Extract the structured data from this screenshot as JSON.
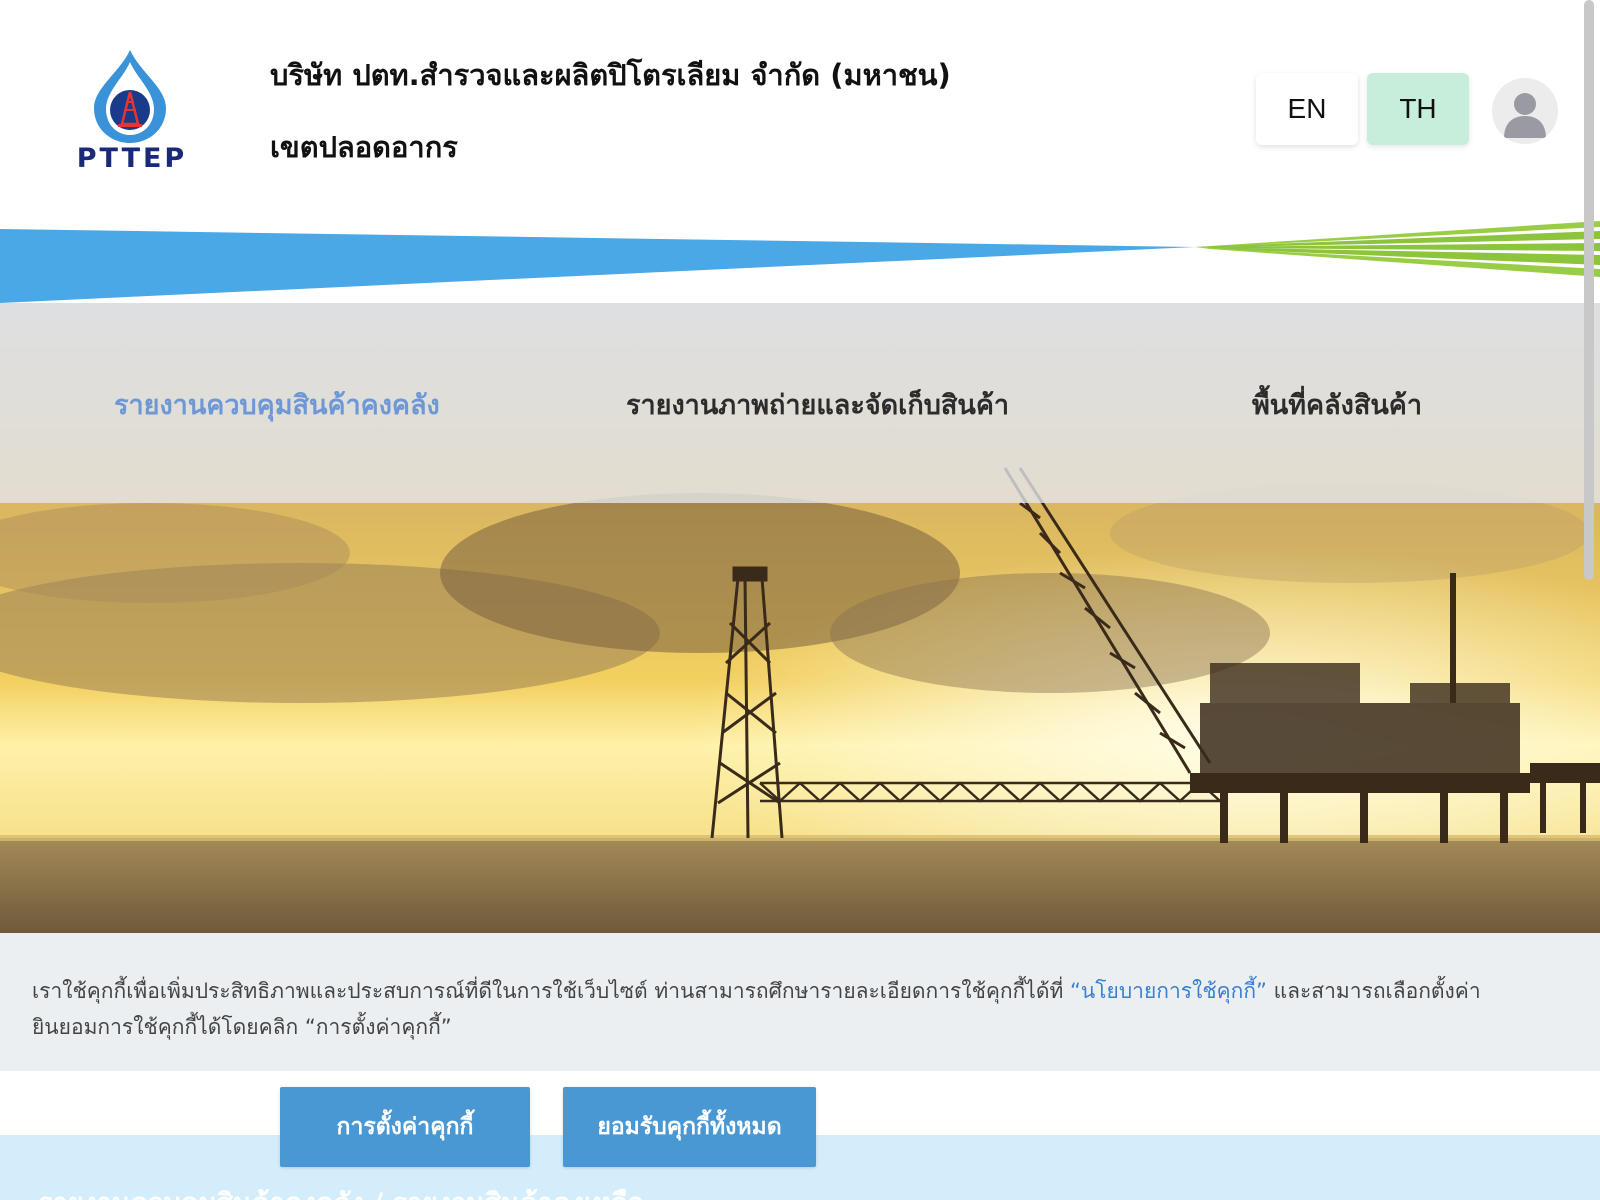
{
  "header": {
    "logo_text": "PTTEP",
    "company_name": "บริษัท ปตท.สำรวจและผลิตปิโตรเลียม จำกัด (มหาชน)",
    "subtitle": "เขตปลอดอากร",
    "lang_en": "EN",
    "lang_th": "TH",
    "active_lang": "TH"
  },
  "nav": {
    "items": [
      {
        "label": "รายงานควบคุมสินค้าคงคลัง",
        "active": true
      },
      {
        "label": "รายงานภาพถ่ายและจัดเก็บสินค้า",
        "active": false
      },
      {
        "label": "พื้นที่คลังสินค้า",
        "active": false
      }
    ]
  },
  "cookie": {
    "text_part1": "เราใช้คุกกี้เพื่อเพิ่มประสิทธิภาพและประสบการณ์ที่ดีในการใช้เว็บไซต์ ท่านสามารถศึกษารายละเอียดการใช้คุกกี้ได้ที่ ",
    "link_text": "“นโยบายการใช้คุกกี้”",
    "text_part2": " และสามารถเลือกตั้งค่ายินยอมการใช้คุกกี้ได้โดยคลิก “การตั้งค่าคุกกี้”",
    "settings_button": "การตั้งค่าคุกกี้",
    "accept_button": "ยอมรับคุกกี้ทั้งหมด"
  },
  "breadcrumb": "รายงานควบคุมสินค้าคงคลัง / รายงานสินค้าคงเหลือ",
  "colors": {
    "accent_blue": "#4a98d3",
    "nav_active": "#6e97d6",
    "lang_active_bg": "#c7eddb",
    "logo_blue": "#1a2a78",
    "stripe_blue": "#4aa8e6",
    "stripe_green": "#8cc43c"
  }
}
